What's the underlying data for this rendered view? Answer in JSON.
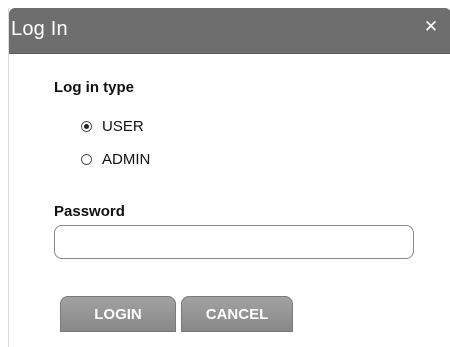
{
  "dialog": {
    "title": "Log In",
    "close_icon": "close-icon"
  },
  "login_type": {
    "label": "Log in type",
    "options": [
      {
        "label": "USER",
        "checked": true
      },
      {
        "label": "ADMIN",
        "checked": false
      }
    ]
  },
  "password": {
    "label": "Password",
    "value": "",
    "placeholder": ""
  },
  "buttons": {
    "login_label": "LOGIN",
    "cancel_label": "CANCEL"
  },
  "colors": {
    "titlebar": "#6e6e6e",
    "button": "#959595"
  }
}
